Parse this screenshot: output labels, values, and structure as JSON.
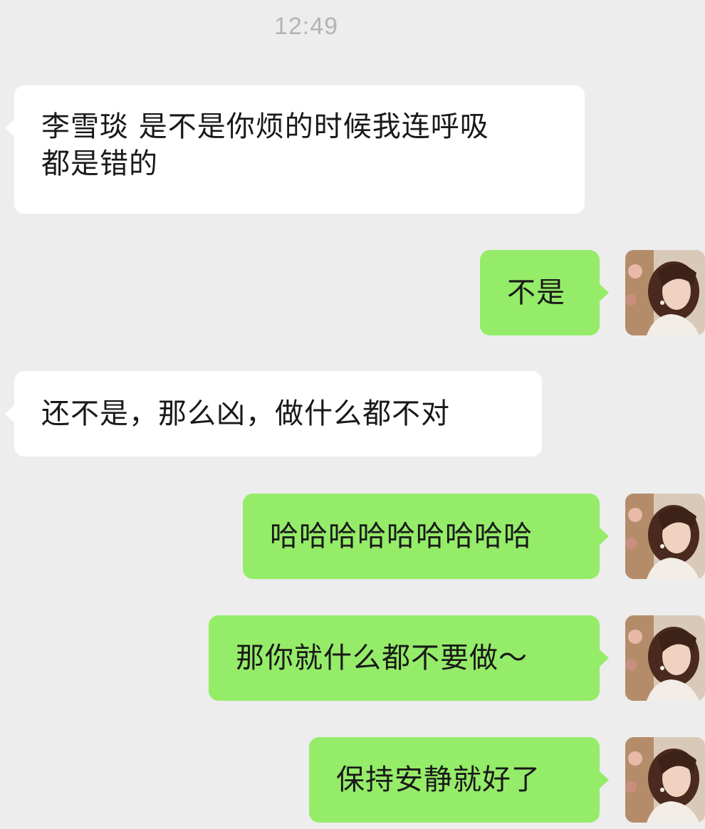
{
  "status": {
    "time": "12:49"
  },
  "messages": [
    {
      "side": "left",
      "lines": [
        "李雪琰 是不是你烦的时候我连呼吸",
        "都是错的"
      ]
    },
    {
      "side": "right",
      "lines": [
        "不是"
      ]
    },
    {
      "side": "left",
      "lines": [
        "还不是，那么凶，做什么都不对"
      ]
    },
    {
      "side": "right",
      "lines": [
        "哈哈哈哈哈哈哈哈哈"
      ]
    },
    {
      "side": "right",
      "lines": [
        "那你就什么都不要做～"
      ]
    },
    {
      "side": "right",
      "lines": [
        "保持安静就好了"
      ]
    }
  ],
  "colors": {
    "background": "#ededed",
    "bubble_left": "#ffffff",
    "bubble_right": "#95ec69",
    "text": "#191919",
    "time": "#b4b4b4"
  },
  "icons": {
    "avatar": "avatar-woman-icon"
  }
}
